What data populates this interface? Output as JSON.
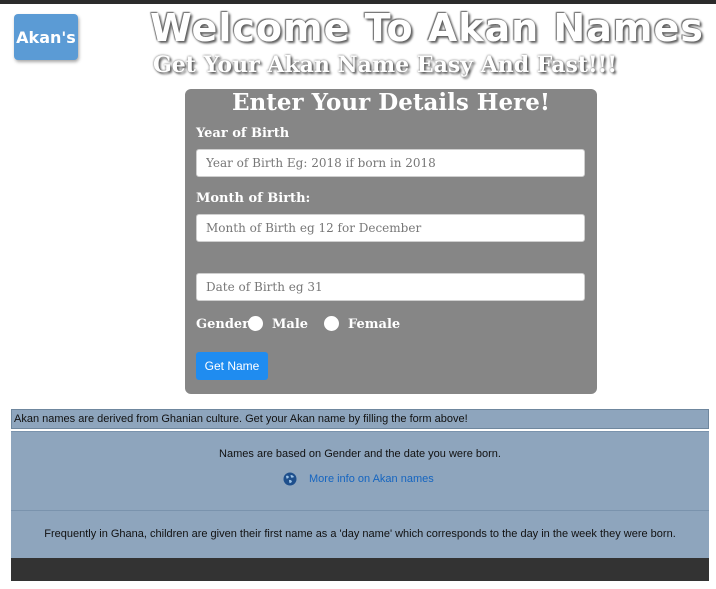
{
  "header": {
    "logo_text": "Akan's",
    "title": "Welcome To Akan Names",
    "subtitle": "Get Your Akan Name Easy And Fast!!!"
  },
  "form": {
    "heading": "Enter Your Details Here!",
    "year_label": "Year of Birth",
    "year_placeholder": "Year of Birth Eg: 2018 if born in 2018",
    "year_value": "",
    "month_label": "Month of Birth:",
    "month_placeholder": "Month of Birth eg 12 for December",
    "month_value": "",
    "date_placeholder": "Date of Birth eg 31",
    "date_value": "",
    "gender_label": "Gender",
    "male_label": "Male",
    "female_label": "Female",
    "submit_label": "Get Name"
  },
  "info": {
    "strip_text": "Akan names are derived from Ghanian culture. Get your Akan name by filling the form above!",
    "body_text": "Names are based on Gender and the date you were born.",
    "link_text": "More info on Akan names",
    "link_icon": "globe-icon",
    "fact_text": "Frequently in Ghana, children are given their first name as a 'day name' which corresponds to the day in the week they were born."
  },
  "colors": {
    "panel": "#868686",
    "button": "#1f8cf0",
    "info_bg": "#8ea5bd",
    "footer": "#333333",
    "link": "#1565c0"
  }
}
